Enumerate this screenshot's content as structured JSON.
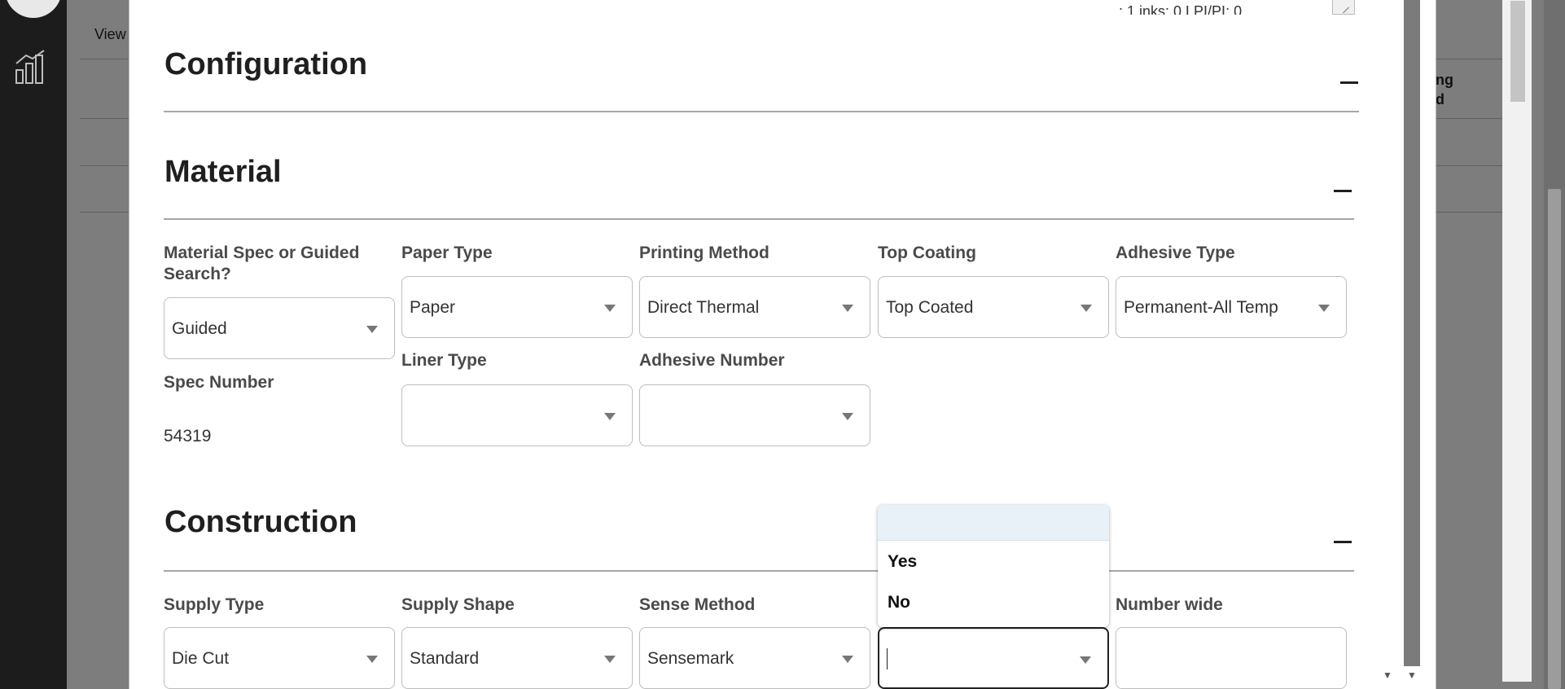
{
  "background": {
    "view_label": "View",
    "column_header": "ting\nod"
  },
  "modal": {
    "top_note": ": 1 inks: 0 LPI/PI: 0",
    "sections": {
      "configuration": {
        "title": "Configuration"
      },
      "material": {
        "title": "Material",
        "fields": {
          "material_spec": {
            "label": "Material Spec or Guided Search?",
            "value": "Guided"
          },
          "paper_type": {
            "label": "Paper Type",
            "value": "Paper"
          },
          "printing_method": {
            "label": "Printing Method",
            "value": "Direct Thermal"
          },
          "top_coating": {
            "label": "Top Coating",
            "value": "Top Coated"
          },
          "adhesive_type": {
            "label": "Adhesive Type",
            "value": "Permanent-All Temp"
          },
          "liner_type": {
            "label": "Liner Type",
            "value": ""
          },
          "adhesive_number": {
            "label": "Adhesive Number",
            "value": ""
          },
          "spec_number": {
            "label": "Spec Number",
            "value": "54319"
          }
        }
      },
      "construction": {
        "title": "Construction",
        "fields": {
          "supply_type": {
            "label": "Supply Type",
            "value": "Die Cut"
          },
          "supply_shape": {
            "label": "Supply Shape",
            "value": "Standard"
          },
          "sense_method": {
            "label": "Sense Method",
            "value": "Sensemark"
          },
          "hidden_field": {
            "value": ""
          },
          "number_wide": {
            "label": "Number wide",
            "value": ""
          }
        }
      }
    },
    "dropdown": {
      "options": [
        "",
        "Yes",
        "No"
      ]
    }
  }
}
